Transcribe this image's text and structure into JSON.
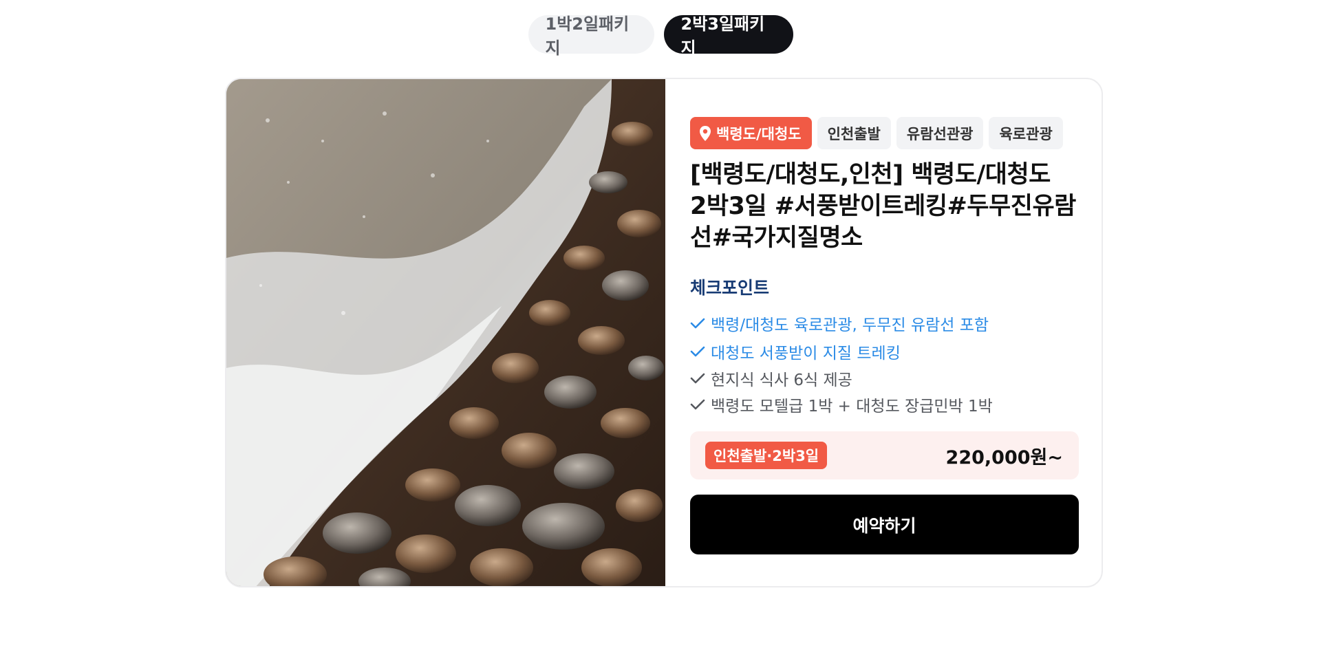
{
  "tabs": [
    {
      "label": "1박2일패키지",
      "active": false
    },
    {
      "label": "2박3일패키지",
      "active": true
    }
  ],
  "card": {
    "photo_alt": "pebble-beach-photo",
    "tags": [
      {
        "label": "백령도/대청도",
        "icon": "location-pin-icon",
        "primary": true
      },
      {
        "label": "인천출발"
      },
      {
        "label": "유람선관광"
      },
      {
        "label": "육로관광"
      }
    ],
    "title_lines": [
      "[백령도/대청도,인천] 백령도/대청도",
      "2박3일 #서풍받이트레킹#두무진유람",
      "선#국가지질명소"
    ],
    "checkpoint_heading": "체크포인트",
    "checkpoints": [
      {
        "text": "백령/대청도 육로관광, 두무진 유람선 포함",
        "highlight": true
      },
      {
        "text": "대청도 서풍받이 지질 트레킹",
        "highlight": true
      },
      {
        "text": "현지식 식사 6식 제공",
        "highlight": false
      },
      {
        "text": "백령도 모텔급 1박 + 대청도 장급민박 1박",
        "highlight": false
      }
    ],
    "price_tag": "인천출발·2박3일",
    "price": "220,000원~",
    "book_label": "예약하기"
  },
  "colors": {
    "accent": "#f15a45",
    "checkpoint_heading": "#173b74",
    "highlight_blue": "#2b8be6",
    "price_bg": "#fdf0ef",
    "tab_active": "#111217"
  }
}
